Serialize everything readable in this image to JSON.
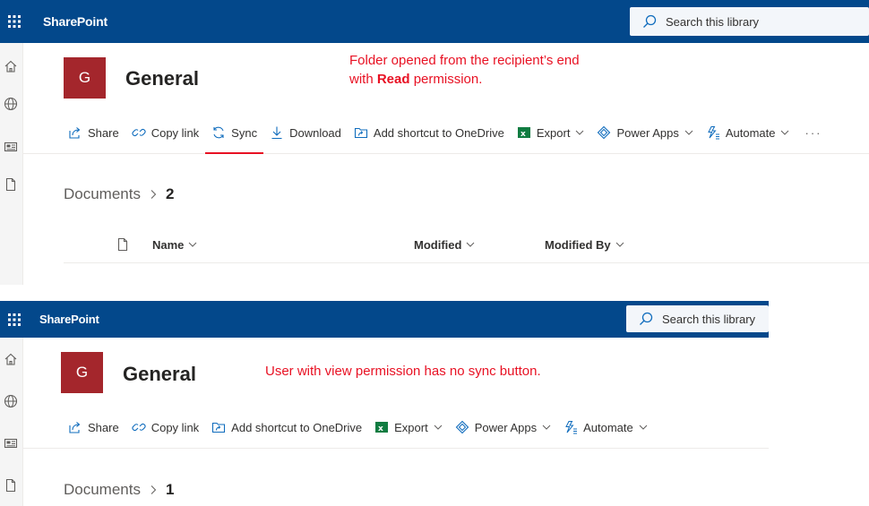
{
  "screens": [
    {
      "brand": "SharePoint",
      "search_placeholder": "Search this library",
      "site_initial": "G",
      "site_title": "General",
      "note_line1": "Folder opened from the recipient’s end",
      "note_line2_prefix": "with ",
      "note_line2_bold": "Read",
      "note_line2_suffix": " permission.",
      "commands": {
        "share": "Share",
        "copy_link": "Copy link",
        "sync": "Sync",
        "download": "Download",
        "add_shortcut": "Add shortcut to OneDrive",
        "export": "Export",
        "power_apps": "Power Apps",
        "automate": "Automate",
        "more": "···"
      },
      "breadcrumb": {
        "root": "Documents",
        "current": "2"
      },
      "columns": {
        "name": "Name",
        "modified": "Modified",
        "modified_by": "Modified By"
      }
    },
    {
      "brand": "SharePoint",
      "search_placeholder": "Search this library",
      "site_initial": "G",
      "site_title": "General",
      "note": "User with view permission has no sync button.",
      "commands": {
        "share": "Share",
        "copy_link": "Copy link",
        "add_shortcut": "Add shortcut to OneDrive",
        "export": "Export",
        "power_apps": "Power Apps",
        "automate": "Automate"
      },
      "breadcrumb": {
        "root": "Documents",
        "current": "1"
      }
    }
  ],
  "colors": {
    "suite_bar": "#03488b",
    "site_logo": "#a4262c",
    "annotation": "#e81123",
    "excel_green": "#107c41"
  }
}
